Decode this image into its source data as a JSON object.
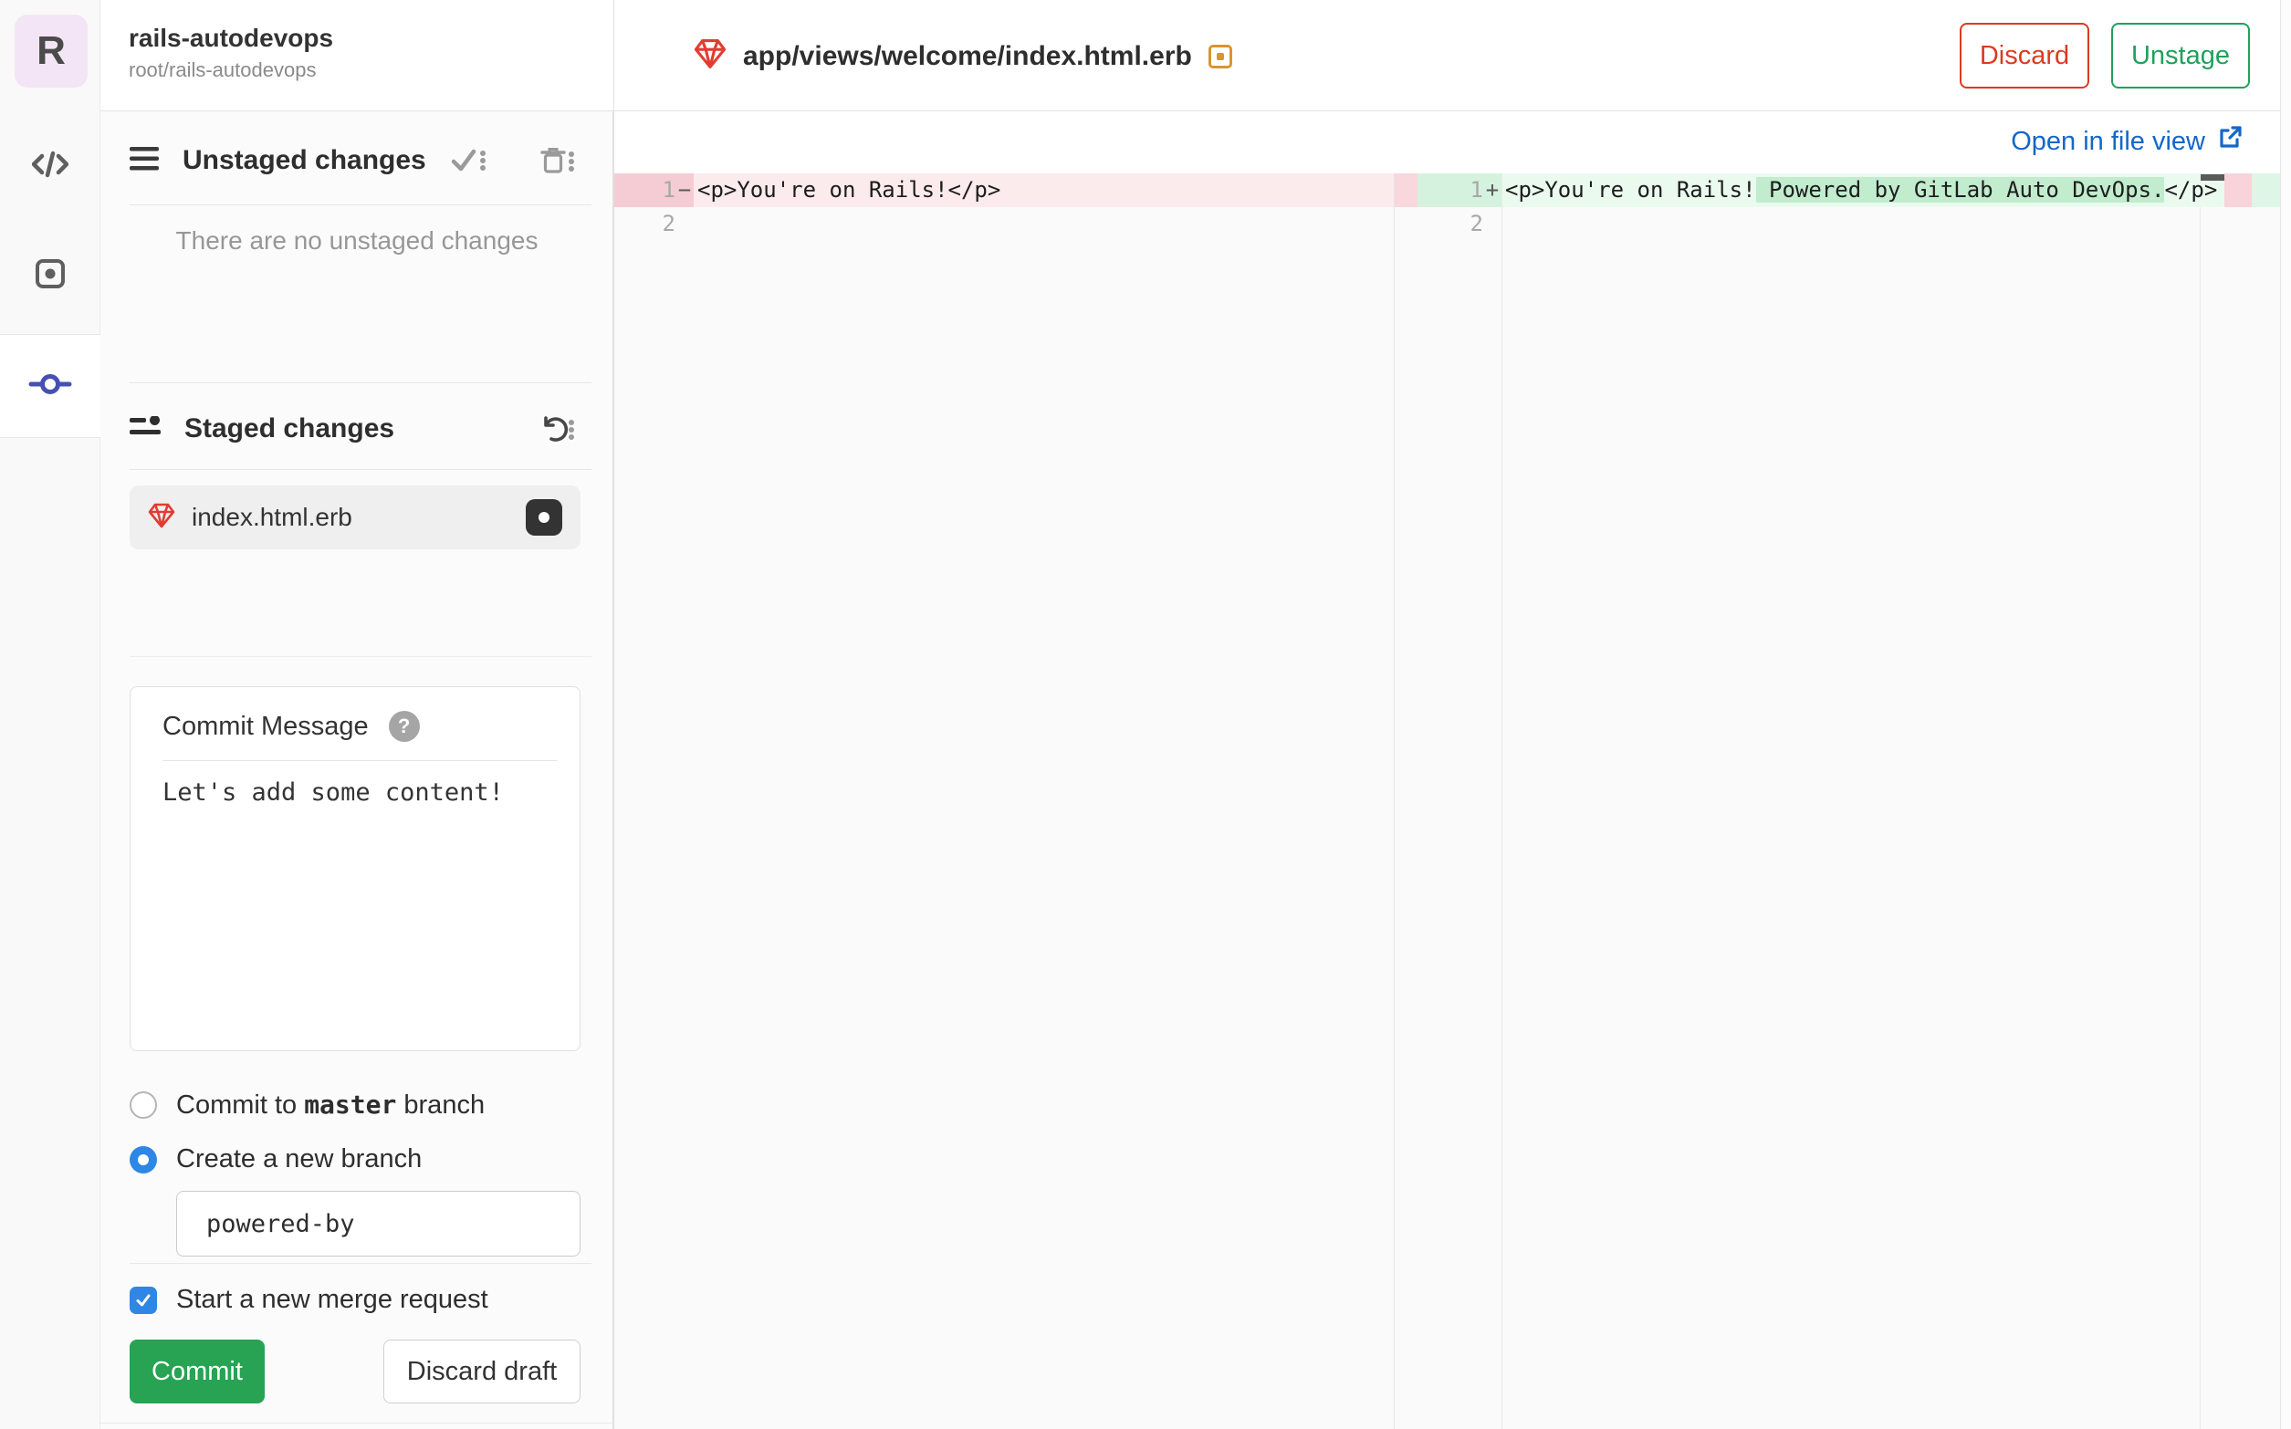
{
  "project": {
    "avatar_letter": "R",
    "name": "rails-autodevops",
    "namespace": "root/rails-autodevops"
  },
  "rail": {
    "items": [
      {
        "id": "edit",
        "icon": "code-icon",
        "active": false
      },
      {
        "id": "review",
        "icon": "review-icon",
        "active": false
      },
      {
        "id": "commit",
        "icon": "commit-icon",
        "active": true
      }
    ]
  },
  "unstaged": {
    "title": "Unstaged changes",
    "empty_message": "There are no unstaged changes",
    "actions": [
      "stage-all",
      "discard-all"
    ]
  },
  "staged": {
    "title": "Staged changes",
    "action": "unstage-all",
    "files": [
      {
        "name": "index.html.erb",
        "icon": "ruby-icon",
        "status": "modified"
      }
    ]
  },
  "commit_form": {
    "label": "Commit Message",
    "message": "Let's add some content!",
    "commit_to_branch": {
      "prefix": "Commit to ",
      "branch": "master",
      "suffix": " branch",
      "selected": false
    },
    "create_new_branch": {
      "label": "Create a new branch",
      "selected": true
    },
    "branch_name": "powered-by",
    "start_mr": {
      "label": "Start a new merge request",
      "checked": true
    },
    "commit_button": "Commit",
    "discard_button": "Discard draft"
  },
  "editor": {
    "file_path": "app/views/welcome/index.html.erb",
    "file_status": "changed",
    "discard_button": "Discard",
    "unstage_button": "Unstage",
    "open_in_file_view": "Open in file view"
  },
  "diff": {
    "left": {
      "lines": [
        {
          "number": "1",
          "sign": "−",
          "text": "<p>You're on Rails!</p>",
          "type": "removed"
        },
        {
          "number": "2",
          "sign": "",
          "text": "",
          "type": "context"
        }
      ]
    },
    "right": {
      "lines": [
        {
          "number": "1",
          "sign": "+",
          "prefix": "<p>You're on Rails!",
          "highlight": " Powered by GitLab Auto DevOps.",
          "suffix": "</p>",
          "type": "added"
        },
        {
          "number": "2",
          "sign": "",
          "prefix": "",
          "highlight": "",
          "suffix": "",
          "type": "context"
        }
      ]
    }
  },
  "colors": {
    "accent_blue": "#2e87e5",
    "link_blue": "#1467c8",
    "commit_green": "#27a353",
    "unstage_green": "#21a05c",
    "discard_red": "#db3b21",
    "added_line_bg": "#eafaef",
    "added_word_bg": "#c1ecce",
    "added_gutter_bg": "#d5f2df",
    "removed_line_bg": "#fcebed",
    "removed_gutter_bg": "#f5ccd3",
    "modified_badge_orange": "#d99530",
    "rail_active_indigo": "#4650b2"
  }
}
